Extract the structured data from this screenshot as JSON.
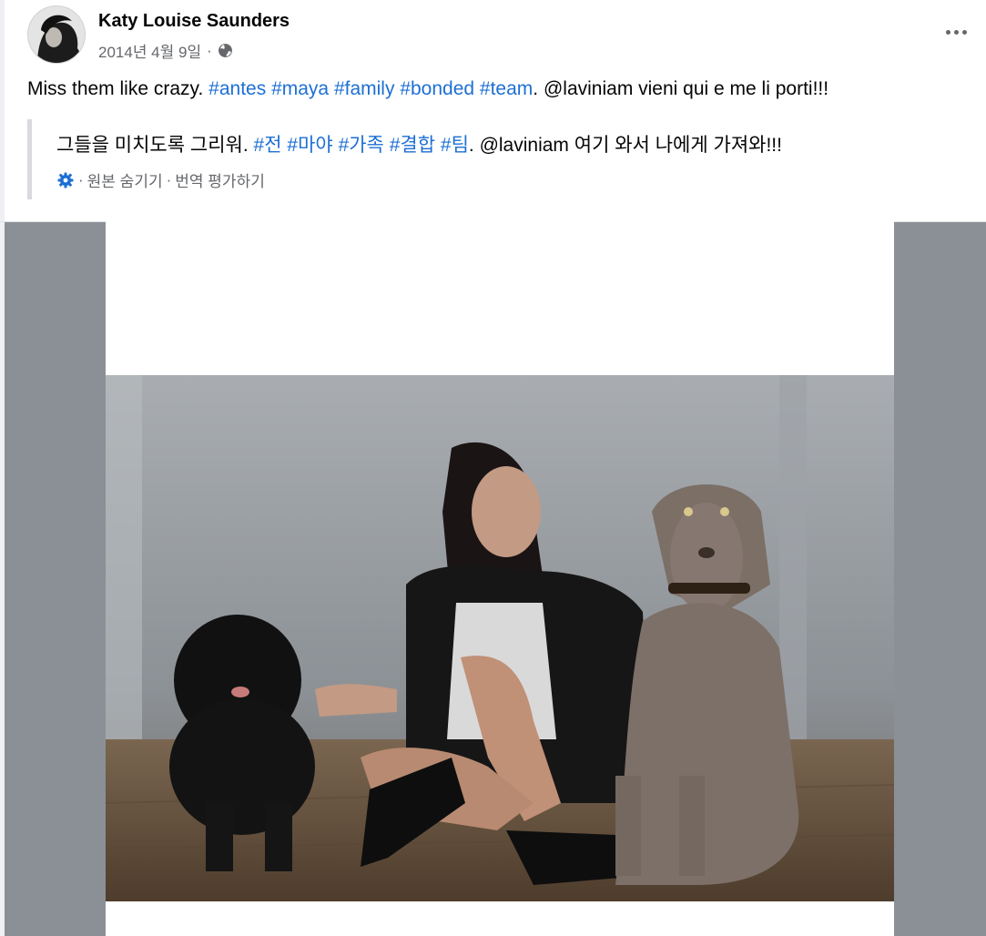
{
  "post": {
    "author": "Katy Louise Saunders",
    "date": "2014년 4월 9일",
    "separator": "·",
    "privacy_icon": "globe-icon",
    "more_icon": "more-horizontal-icon",
    "message": {
      "text_before": "Miss them like crazy.",
      "hashtags": [
        "#antes",
        "#maya",
        "#family",
        "#bonded",
        "#team"
      ],
      "text_after": ". @laviniam vieni qui e me li porti!!!"
    },
    "translation": {
      "text_before": "그들을 미치도록 그리워.",
      "hashtags": [
        "#전",
        "#마야",
        "#가족",
        "#결합",
        "#팀"
      ],
      "text_after": ". @laviniam 여기 와서 나에게 가져와!!!",
      "settings_icon": "gear-icon",
      "hide_original": "원본 숨기기",
      "rate_translation": "번역 평가하기"
    }
  },
  "colors": {
    "hashtag": "#1d6fd4",
    "secondary_text": "#65676b",
    "media_background": "#8a9096"
  }
}
